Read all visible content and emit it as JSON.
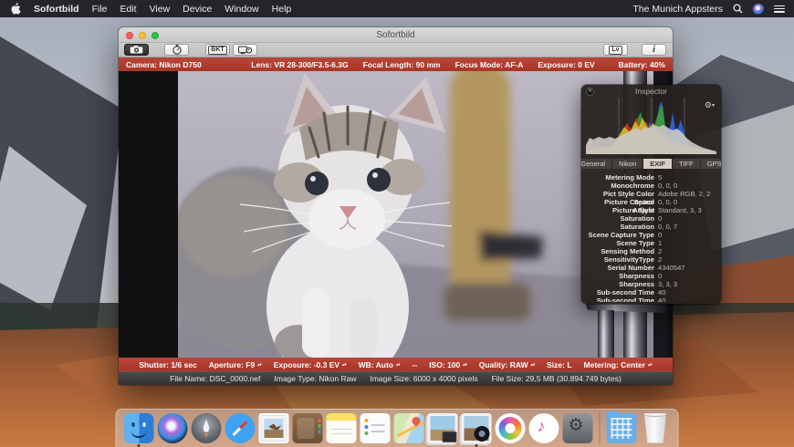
{
  "menu_bar": {
    "app_name": "Sofortbild",
    "menus": [
      "File",
      "Edit",
      "View",
      "Device",
      "Window",
      "Help"
    ],
    "right_text": "The Munich Appsters",
    "icons": [
      "apple-icon",
      "search-icon",
      "siri-icon",
      "notification-center-icon"
    ]
  },
  "window": {
    "title": "Sofortbild",
    "toolbar": {
      "icons": [
        "camera-capture-icon",
        "timer-icon",
        "bracketing-button",
        "liveview-timer-icon",
        "liveview-button",
        "info-button"
      ],
      "bkt_label": "BKT",
      "lv_label": "Lv",
      "info_label": "i"
    },
    "top_status_bar": {
      "camera": "Camera: Nikon D750",
      "lens": "Lens: VR 28-300/F3.5-6.3G",
      "focal_length": "Focal Length: 90 mm",
      "focus_mode": "Focus Mode: AF-A",
      "exposure": "Exposure: 0 EV",
      "battery": "Battery: 40%"
    },
    "settings_bar": {
      "items": [
        {
          "label": "Shutter: 1/6 sec",
          "stepper": false
        },
        {
          "label": "Aperture: F9",
          "stepper": true
        },
        {
          "label": "Exposure: -0.3 EV",
          "stepper": true
        },
        {
          "label": "WB: Auto",
          "stepper": true
        },
        {
          "label": "--",
          "stepper": false
        },
        {
          "label": "ISO: 100",
          "stepper": true
        },
        {
          "label": "Quality: RAW",
          "stepper": true
        },
        {
          "label": "Size: L",
          "stepper": false
        },
        {
          "label": "Metering: Center",
          "stepper": true
        }
      ]
    },
    "info_bar": {
      "file_name": "File Name: DSC_0000.nef",
      "image_type": "Image Type: Nikon Raw",
      "image_size": "Image Size: 6000 x 4000 pixels",
      "file_size": "File Size: 29,5 MB (30.894.749 bytes)"
    }
  },
  "inspector": {
    "title": "Inspector",
    "histogram_channels": [
      "red",
      "green",
      "blue",
      "luminance"
    ],
    "tabs": [
      {
        "label": "General",
        "active": false
      },
      {
        "label": "Nikon",
        "active": false
      },
      {
        "label": "EXIF",
        "active": true
      },
      {
        "label": "TIFF",
        "active": false
      },
      {
        "label": "GPS",
        "active": false
      }
    ],
    "exif_rows": [
      {
        "label": "Metering Mode",
        "value": "5"
      },
      {
        "label": "Monochrome",
        "value": "0, 0, 0"
      },
      {
        "label": "Pict Style Color Space",
        "value": "Adobe RGB, 2, 2"
      },
      {
        "label": "Picture Control Adjust",
        "value": "0, 0, 0"
      },
      {
        "label": "Picture Style",
        "value": "Standard, 3, 3"
      },
      {
        "label": "Saturation",
        "value": "0"
      },
      {
        "label": "Saturation",
        "value": "0, 0, 7"
      },
      {
        "label": "Scene Capture Type",
        "value": "0"
      },
      {
        "label": "Scene Type",
        "value": "1"
      },
      {
        "label": "Sensing Method",
        "value": "2"
      },
      {
        "label": "SensitivityType",
        "value": "2"
      },
      {
        "label": "Serial Number",
        "value": "4340547"
      },
      {
        "label": "Sharpness",
        "value": "0"
      },
      {
        "label": "Sharpness",
        "value": "3, 3, 3"
      },
      {
        "label": "Sub-second Time",
        "value": "40"
      },
      {
        "label": "Sub-second Time Digiti",
        "value": "40"
      }
    ]
  },
  "dock": {
    "items": [
      "Finder",
      "Siri",
      "Launchpad",
      "Safari",
      "Mail",
      "Contacts",
      "Notes",
      "Reminders",
      "Maps",
      "Image Capture",
      "Sofortbild",
      "Photos",
      "iTunes",
      "System Preferences",
      "Downloads",
      "Trash"
    ],
    "running_apps": [
      "Finder",
      "Sofortbild"
    ]
  },
  "colors": {
    "status_bar_red": "#a93527",
    "menu_bar_bg": "#1c1c20",
    "inspector_bg": "#26211e",
    "exif_tab_active_bg": "#d6cfc8"
  }
}
